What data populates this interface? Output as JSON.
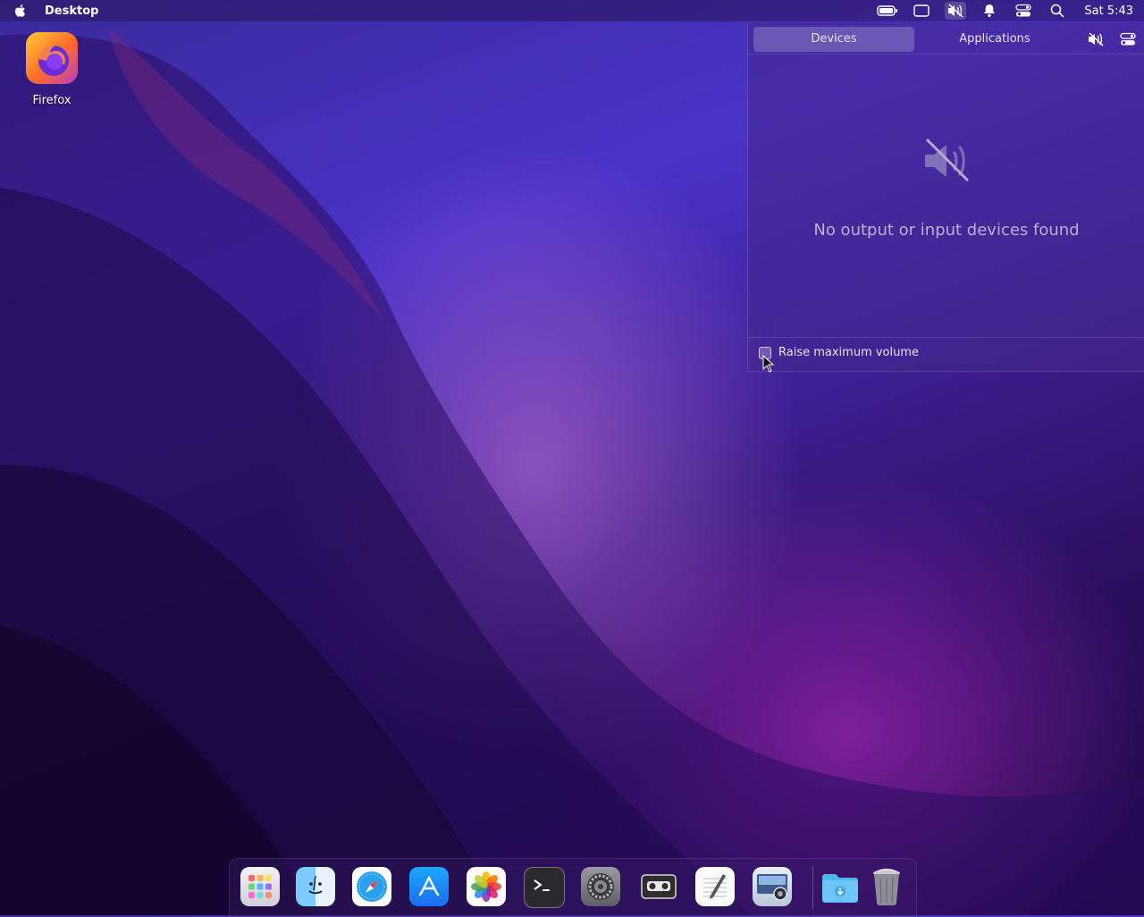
{
  "menubar": {
    "app_name": "Desktop",
    "clock": "Sat 5:43",
    "icons": [
      "battery-icon",
      "display-icon",
      "volume-muted-icon",
      "notification-bell-icon",
      "control-center-icon",
      "search-icon"
    ]
  },
  "desktop": {
    "icons": [
      {
        "label": "Firefox",
        "icon": "firefox-icon"
      }
    ]
  },
  "sound_panel": {
    "tabs": [
      {
        "label": "Devices",
        "active": true
      },
      {
        "label": "Applications",
        "active": false
      }
    ],
    "empty_message": "No output or input devices found",
    "raise_max_volume_label": "Raise maximum volume",
    "raise_max_volume_checked": false
  },
  "dock": {
    "items": [
      "launchpad-icon",
      "finder-icon",
      "safari-icon",
      "app-store-icon",
      "photos-icon",
      "terminal-icon",
      "system-preferences-icon",
      "cassette-icon",
      "text-editor-icon",
      "screenshot-icon",
      "downloads-folder-icon",
      "trash-icon"
    ]
  }
}
